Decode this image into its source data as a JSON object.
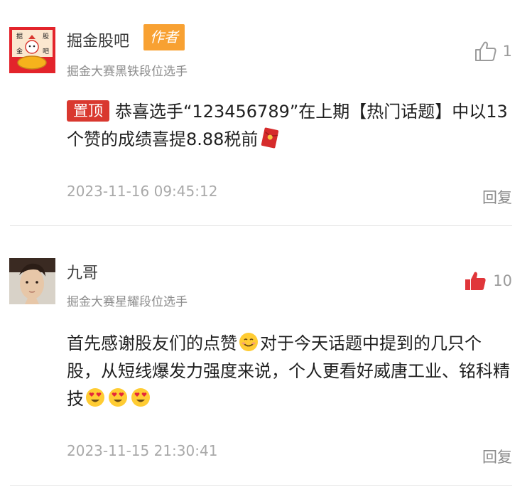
{
  "comments": [
    {
      "username": "掘金股吧",
      "author_badge": "作者",
      "user_title": "掘金大赛黑铁段位选手",
      "like_count": "1",
      "liked": false,
      "pin_badge": "置顶",
      "content": "恭喜选手“123456789”在上期【热门话题】中以13个赞的成绩喜提8.88税前",
      "content_emoji": "red-envelope-icon",
      "timestamp": "2023-11-16 09:45:12",
      "reply_label": "回复",
      "avatar_text": [
        "掘",
        "股",
        "金",
        "吧"
      ]
    },
    {
      "username": "九哥",
      "user_title": "掘金大赛星耀段位选手",
      "like_count": "10",
      "liked": true,
      "content_parts": [
        "首先感谢股友们的点赞",
        "对于今天话题中提到的几只个股，从短线爆发力强度来说，个人更看好威唐工业、铭科精技"
      ],
      "content_emojis": [
        "smiling-face-icon",
        "heart-eyes-icon",
        "heart-eyes-icon",
        "heart-eyes-icon"
      ],
      "timestamp": "2023-11-15 21:30:41",
      "reply_label": "回复"
    }
  ],
  "colors": {
    "author_badge_bg": "#f8a132",
    "pin_badge_bg": "#d9382f",
    "liked_thumb": "#e0363a",
    "unliked_thumb": "#9b9b9b",
    "muted_text": "#8c8c8c",
    "timestamp_text": "#a9a9a9"
  }
}
